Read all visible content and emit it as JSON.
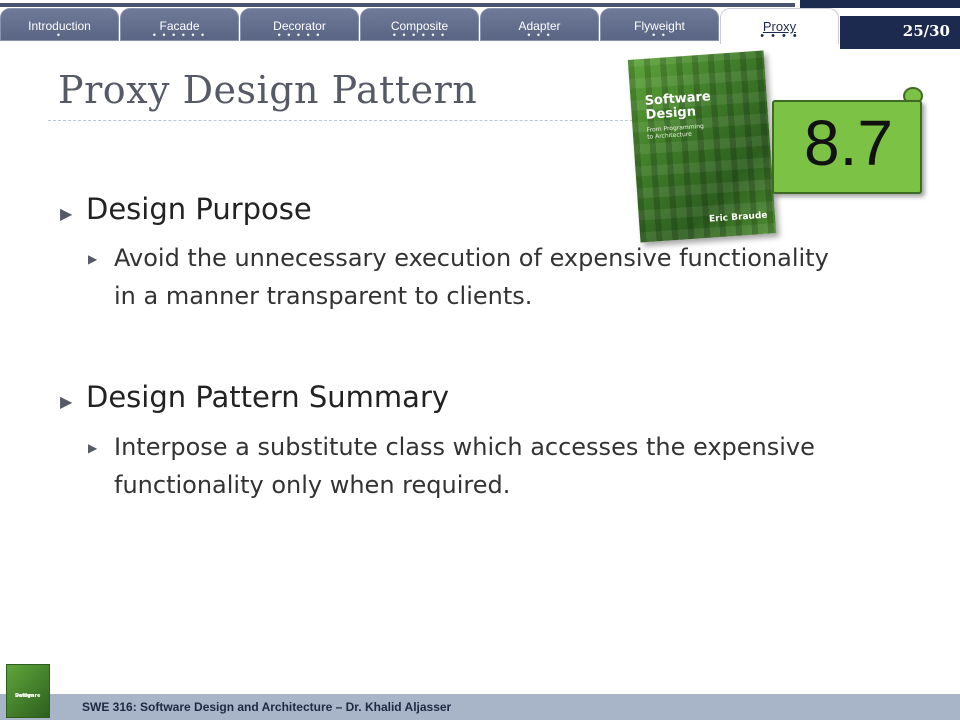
{
  "nav": {
    "tabs": [
      {
        "label": "Introduction",
        "dots": "•"
      },
      {
        "label": "Facade",
        "dots": "• • • • • •"
      },
      {
        "label": "Decorator",
        "dots": "• • • • •"
      },
      {
        "label": "Composite",
        "dots": "• • • • • •"
      },
      {
        "label": "Adapter",
        "dots": "• • •"
      },
      {
        "label": "Flyweight",
        "dots": "• •"
      },
      {
        "label": "Proxy",
        "dots": "• • • •"
      }
    ],
    "active_tab": "Proxy",
    "page_indicator": "25/30"
  },
  "slide": {
    "title": "Proxy Design Pattern",
    "section_number": "8.7",
    "book": {
      "title_line1": "Software",
      "title_line2": "Design",
      "subtitle_line1": "From Programming",
      "subtitle_line2": "to Architecture",
      "author": "Eric Braude"
    },
    "bullets": [
      {
        "heading": "Design Purpose",
        "sub": [
          "Avoid the unnecessary execution of expensive functionality",
          "in a manner transparent to clients."
        ]
      },
      {
        "heading": "Design Pattern Summary",
        "sub": [
          "Interpose a substitute class which accesses the expensive",
          "functionality only when required."
        ]
      }
    ]
  },
  "footer": {
    "text": "SWE 316: Software Design and Architecture – Dr. Khalid Aljasser",
    "thumb_line1": "Software",
    "thumb_line2": "Design"
  },
  "colors": {
    "nav_tab": "#5a6584",
    "nav_dark": "#1d2a4f",
    "badge_green": "#7cc244",
    "footer_bg": "#a8b4c8",
    "title_gray": "#555a66"
  }
}
